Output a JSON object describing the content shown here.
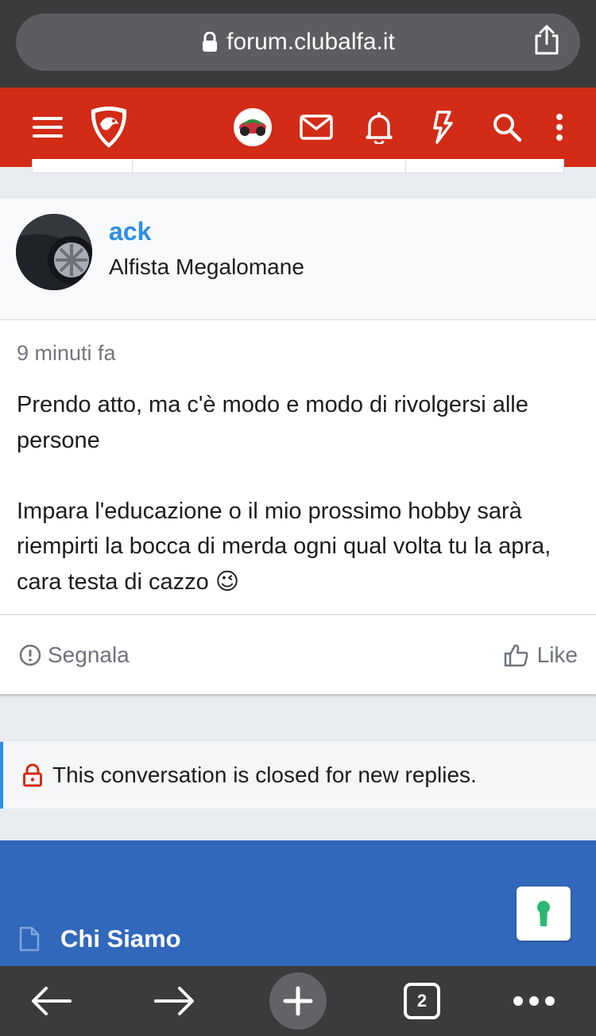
{
  "browser": {
    "url": "forum.clubalfa.it",
    "tab_count": "2"
  },
  "site_nav": {
    "icons": [
      "menu-icon",
      "site-logo",
      "user-avatar",
      "mail-icon",
      "bell-icon",
      "activity-icon",
      "search-icon",
      "more-icon"
    ],
    "brand_color": "#d22b16"
  },
  "post": {
    "author": "ack",
    "author_title": "Alfista Megalomane",
    "time": "9 minuti fa",
    "paragraphs": [
      "Prendo atto, ma c'è modo e modo di rivolgersi alle persone",
      "Impara l'educazione o il mio prossimo hobby sarà riempirti la bocca di merda ogni qual volta tu la apra, cara testa di cazzo"
    ],
    "emoji": "😉",
    "report_label": "Segnala",
    "like_label": "Like"
  },
  "notice": {
    "text": "This conversation is closed for new replies."
  },
  "footer": {
    "link_label": "Chi Siamo",
    "color": "#3168bb"
  }
}
